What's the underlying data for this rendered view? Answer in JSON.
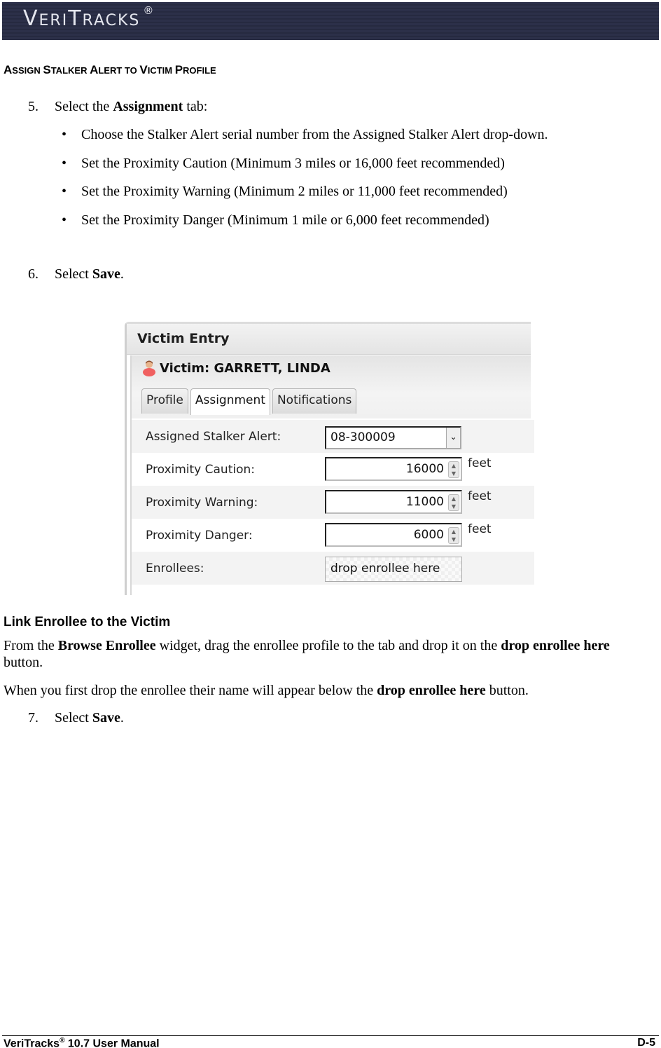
{
  "header": {
    "logo_first": "V",
    "logo_rest1": "ERI",
    "logo_mid": "T",
    "logo_rest2": "RACKS",
    "logo_reg": "®"
  },
  "section": {
    "title_parts": [
      {
        "cap": "A",
        "rest": "SSIGN "
      },
      {
        "cap": "S",
        "rest": "TALKER "
      },
      {
        "cap": "A",
        "rest": "LERT TO "
      },
      {
        "cap": "V",
        "rest": "ICTIM "
      },
      {
        "cap": "P",
        "rest": "ROFILE"
      }
    ]
  },
  "steps": {
    "step5": {
      "num": "5.",
      "pre": "Select the ",
      "bold": "Assignment",
      "post": " tab:"
    },
    "bullets": [
      "Choose the Stalker Alert serial number from the Assigned Stalker Alert drop-down.",
      "Set the Proximity Caution (Minimum 3 miles or 16,000 feet recommended)",
      "Set the Proximity Warning (Minimum 2 miles or 11,000 feet recommended)",
      "Set the Proximity Danger (Minimum 1 mile or 6,000 feet recommended)"
    ],
    "bullet_glyph": "•",
    "step6": {
      "num": "6.",
      "pre": "Select ",
      "bold": "Save",
      "post": "."
    },
    "step7": {
      "num": "7.",
      "pre": "Select ",
      "bold": "Save",
      "post": "."
    }
  },
  "screenshot": {
    "window_title": "Victim Entry",
    "victim_label": "Victim: GARRETT, LINDA",
    "tabs": [
      {
        "label": "Profile",
        "active": false
      },
      {
        "label": "Assignment",
        "active": true
      },
      {
        "label": "Notifications",
        "active": false
      }
    ],
    "fields": {
      "stalker_alert": {
        "label": "Assigned Stalker Alert:",
        "value": "08-300009",
        "arrow": "⌄"
      },
      "caution": {
        "label": "Proximity Caution:",
        "value": "16000",
        "unit": "feet"
      },
      "warning": {
        "label": "Proximity Warning:",
        "value": "11000",
        "unit": "feet"
      },
      "danger": {
        "label": "Proximity Danger:",
        "value": "6000",
        "unit": "feet"
      },
      "enrollees": {
        "label": "Enrollees:",
        "button": "drop enrollee here"
      }
    },
    "spin_up": "▲",
    "spin_down": "▼"
  },
  "link_section": {
    "title": "Link Enrollee to the Victim",
    "p1": {
      "t1": "From the ",
      "b1": "Browse Enrollee",
      "t2": " widget, drag the enrollee profile to the tab and drop it on the ",
      "b2": "drop enrollee here",
      "t3": " button."
    },
    "p2": {
      "t1": "When you first drop the enrollee their name will appear below the ",
      "b1": "drop enrollee here",
      "t2": " button."
    }
  },
  "footer": {
    "brand": "VeriTracks",
    "reg": "®",
    "rest": " 10.7 User Manual",
    "page": "D-5"
  }
}
